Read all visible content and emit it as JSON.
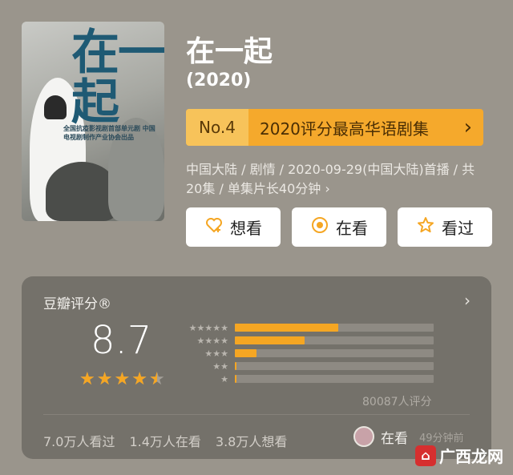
{
  "poster": {
    "title": "在一起",
    "subtitle": "全国抗疫影视剧首部单元剧 中国电视剧制作产业协会出品"
  },
  "header": {
    "title": "在一起",
    "year": "(2020)"
  },
  "rank": {
    "number": "No.4",
    "text": "2020评分最高华语剧集",
    "chevron": "›"
  },
  "meta": {
    "text": "中国大陆 / 剧情 / 2020-09-29(中国大陆)首播 / 共20集 / 单集片长40分钟 ›"
  },
  "actions": [
    {
      "label": "想看",
      "icon": "heart-plus-icon"
    },
    {
      "label": "在看",
      "icon": "target-icon"
    },
    {
      "label": "看过",
      "icon": "star-icon"
    }
  ],
  "rating": {
    "title": "豆瓣评分®",
    "chevron": "›",
    "score": "8.7",
    "stars": 4.5,
    "distribution": [
      0.52,
      0.35,
      0.11,
      0.01,
      0.01
    ],
    "count_text": "80087人评分"
  },
  "stats": {
    "watched": "7.0万人看过",
    "watching": "1.4万人在看",
    "want": "3.8万人想看"
  },
  "watching_now": {
    "label": "在看",
    "time": "49分钟前"
  },
  "watermark": {
    "text": "广西龙网"
  },
  "colors": {
    "accent": "#f5a623",
    "rank_bg": "#f5a92c",
    "card_bg": "#74716a"
  }
}
